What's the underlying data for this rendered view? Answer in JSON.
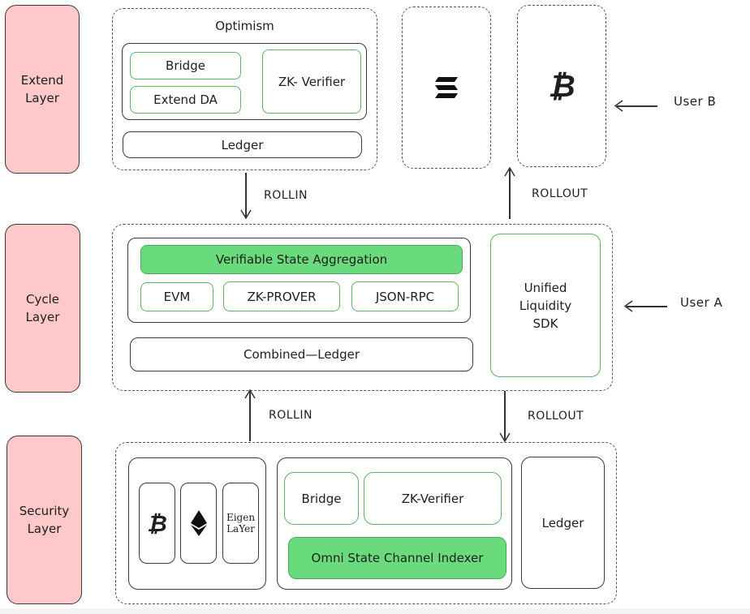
{
  "layers": {
    "extend": "Extend\nLayer",
    "cycle": "Cycle\nLayer",
    "security": "Security\nLayer"
  },
  "extend_layer": {
    "title": "Optimism",
    "bridge": "Bridge",
    "extend_da": "Extend DA",
    "zk_verifier": "ZK- Verifier",
    "ledger": "Ledger",
    "chain_icons": [
      "solana-icon",
      "bitcoin-icon"
    ]
  },
  "cycle_layer": {
    "vsa": "Verifiable State Aggregation",
    "evm": "EVM",
    "zk_prover": "ZK-PROVER",
    "json_rpc": "JSON-RPC",
    "combined_ledger": "Combined—Ledger",
    "sdk": "Unified\nLiquidity\nSDK"
  },
  "security_layer": {
    "chains": [
      "bitcoin-icon",
      "ethereum-icon",
      "eigenlayer-logo"
    ],
    "eigen_top": "Eigen",
    "eigen_bottom": "LaYer",
    "bridge": "Bridge",
    "zk_verifier": "ZK-Verifier",
    "indexer": "Omni State Channel Indexer",
    "ledger": "Ledger"
  },
  "arrows": {
    "rollin_top": "ROLLIN",
    "rollout_top": "ROLLOUT",
    "rollin_bottom": "ROLLIN",
    "rollout_bottom": "ROLLOUT"
  },
  "users": {
    "user_a": "User A",
    "user_b": "User B"
  },
  "colors": {
    "layer_fill": "#ffc9c9",
    "green_fill": "#69db7c",
    "green_stroke": "#5cb46a"
  }
}
